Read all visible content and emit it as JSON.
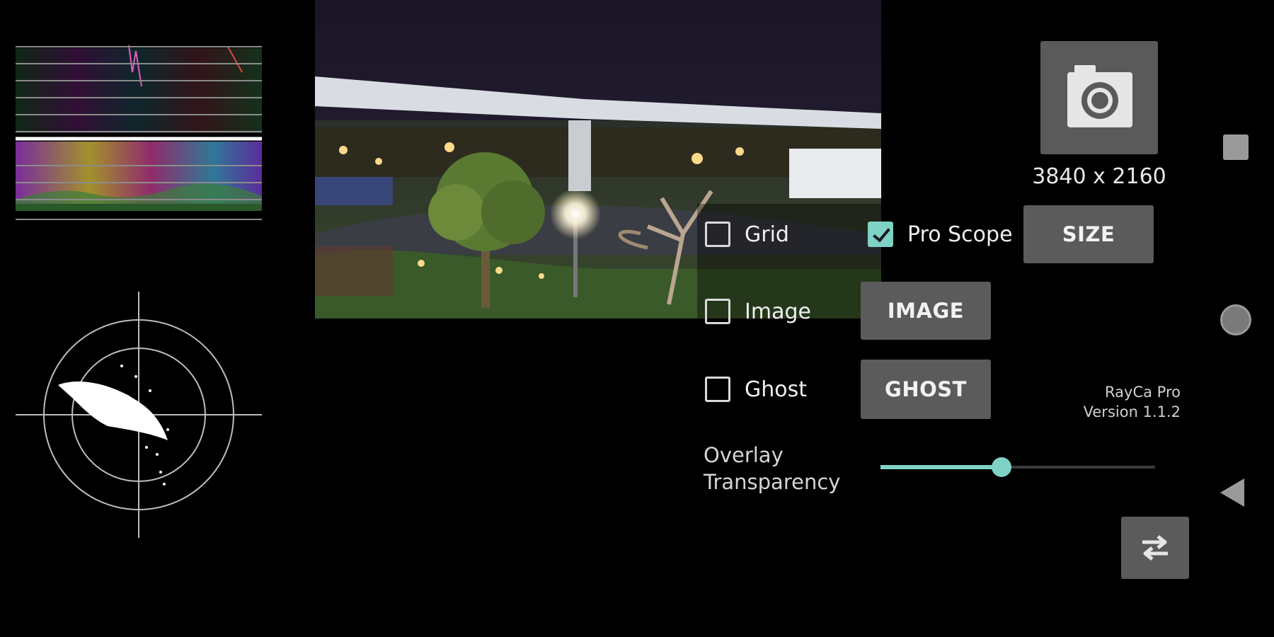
{
  "scopes": {
    "waveform_icon": "waveform-scope",
    "vectorscope_icon": "vectorscope"
  },
  "preview": {
    "description_icon": "camera-preview-night-scene"
  },
  "shutter": {
    "icon": "camera-icon"
  },
  "resolution": "3840 x 2160",
  "controls": {
    "grid": {
      "label": "Grid",
      "checked": false
    },
    "pro_scope": {
      "label": "Pro Scope",
      "checked": true
    },
    "image": {
      "label": "Image",
      "checked": false
    },
    "ghost": {
      "label": "Ghost",
      "checked": false
    },
    "size_button": "SIZE",
    "image_button": "IMAGE",
    "ghost_button": "GHOST"
  },
  "app": {
    "name": "RayCa Pro",
    "version": "Version 1.1.2"
  },
  "overlay": {
    "label": "Overlay Transparency",
    "value": 0.44
  },
  "swap_button_icon": "swap-arrows-icon",
  "nav": {
    "recent_icon": "square-icon",
    "home_icon": "circle-icon",
    "back_icon": "triangle-back-icon"
  },
  "colors": {
    "accent": "#7ed3c6",
    "button": "#5b5b5b",
    "background": "#000000"
  }
}
